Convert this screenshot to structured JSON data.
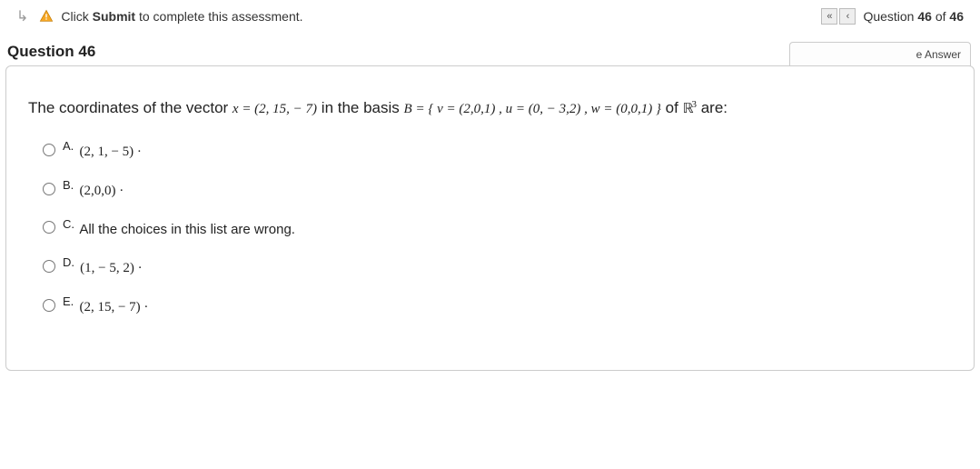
{
  "header": {
    "instruction_prefix": "Click ",
    "instruction_bold": "Submit",
    "instruction_suffix": " to complete this assessment.",
    "nav_first": "«",
    "nav_prev": "‹",
    "counter_prefix": "Question ",
    "counter_num": "46",
    "counter_mid": " of ",
    "counter_total": "46"
  },
  "question": {
    "title": "Question 46",
    "answer_tab": "e Answer",
    "stem_part1": "The coordinates of the vector ",
    "stem_vector_x": "x = (2, 15, − 7)",
    "stem_part2": " in the basis ",
    "stem_basis": "B = { v = (2,0,1) , u = (0, − 3,2) , w = (0,0,1) }",
    "stem_part3": " of ",
    "stem_space_R": "ℝ",
    "stem_space_exp": "3",
    "stem_part4": " are:"
  },
  "choices": [
    {
      "letter": "A.",
      "text": "(2, 1, − 5) ·"
    },
    {
      "letter": "B.",
      "text": "(2,0,0) ·"
    },
    {
      "letter": "C.",
      "text": "All the choices in this list are wrong."
    },
    {
      "letter": "D.",
      "text": "(1, − 5, 2) ·"
    },
    {
      "letter": "E.",
      "text": "(2, 15, − 7) ·"
    }
  ]
}
